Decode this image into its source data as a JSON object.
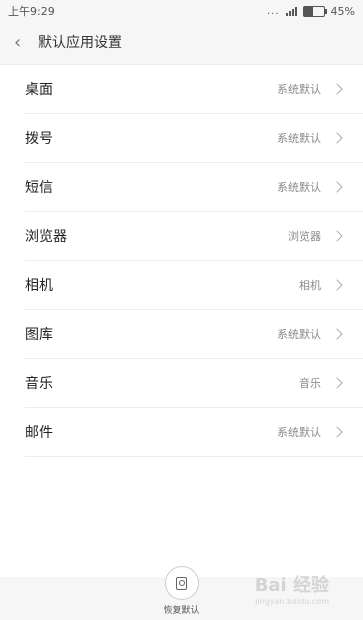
{
  "status_bar": {
    "time": "上午9:29",
    "dots": "...",
    "signal_label": "ııll",
    "battery_percent": "45%"
  },
  "header": {
    "title": "默认应用设置"
  },
  "settings": [
    {
      "label": "桌面",
      "value": "系统默认"
    },
    {
      "label": "拨号",
      "value": "系统默认"
    },
    {
      "label": "短信",
      "value": "系统默认"
    },
    {
      "label": "浏览器",
      "value": "浏览器"
    },
    {
      "label": "相机",
      "value": "相机"
    },
    {
      "label": "图库",
      "value": "系统默认"
    },
    {
      "label": "音乐",
      "value": "音乐"
    },
    {
      "label": "邮件",
      "value": "系统默认"
    }
  ],
  "restore": {
    "label": "恢复默认"
  },
  "watermark": {
    "text": "Bai 经验",
    "url": "jingyan.baidu.com"
  }
}
